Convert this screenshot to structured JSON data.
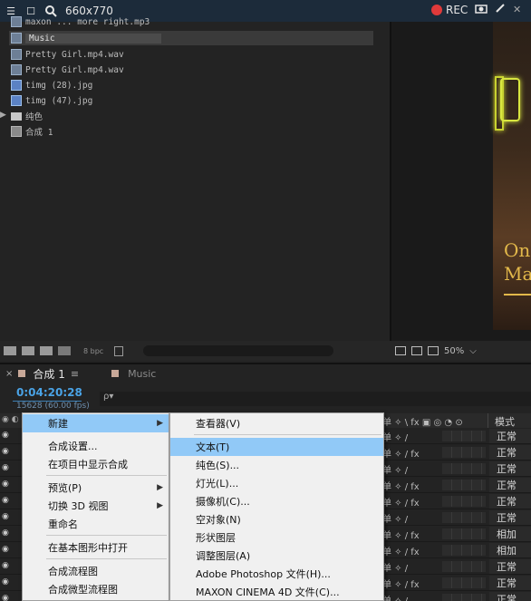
{
  "topbar": {
    "size_label": "660x770",
    "rec_label": "REC",
    "icons": [
      "menu-icon",
      "window-icon",
      "search-icon",
      "record-dot-icon",
      "camera-icon",
      "pen-icon",
      "close-icon"
    ]
  },
  "project": {
    "items": [
      {
        "label": "maxon ... more right.mp3",
        "icon": "audio-file-icon"
      },
      {
        "label": "Music",
        "icon": "audio-file-icon",
        "selected": true
      },
      {
        "label": "Pretty Girl.mp4.wav",
        "icon": "audio-file-icon"
      },
      {
        "label": "Pretty Girl.mp4.wav",
        "icon": "audio-file-icon"
      },
      {
        "label": "timg (28).jpg",
        "icon": "image-file-icon"
      },
      {
        "label": "timg (47).jpg",
        "icon": "image-file-icon"
      },
      {
        "label": "纯色",
        "icon": "folder-icon"
      },
      {
        "label": "合成 1",
        "icon": "composition-icon"
      }
    ],
    "footer": {
      "bpc": "8 bpc"
    }
  },
  "viewer": {
    "brand_line1": "On",
    "brand_line2": "Ma",
    "zoom": "50%"
  },
  "timeline": {
    "tab_active": "合成 1",
    "tab_other": "Music",
    "timecode": "0:04:20:28",
    "frames": "15628 (60.00 fps)",
    "search_placeholder": "ρ▾",
    "switches_header": "单 ✧ \\ fx ▣ ◎ ◔ ⊙",
    "mode_header": "模式",
    "rows": [
      {
        "mode": "正常",
        "sw": "单 ✧ /"
      },
      {
        "mode": "正常",
        "sw": "单 ✧ / fx"
      },
      {
        "mode": "正常",
        "sw": "单 ✧ /"
      },
      {
        "mode": "正常",
        "sw": "单 ✧ / fx"
      },
      {
        "mode": "正常",
        "sw": "单 ✧ / fx"
      },
      {
        "mode": "正常",
        "sw": "单 ✧ /"
      },
      {
        "mode": "正常",
        "sw": "单 ✧ /"
      },
      {
        "mode": "正常",
        "sw": "单 ✧ /"
      },
      {
        "mode": "相加",
        "sw": "单 ✧ / fx"
      },
      {
        "mode": "相加",
        "sw": "单 ✧ / fx"
      },
      {
        "mode": "正常",
        "sw": "单 ✧ /"
      },
      {
        "mode": "正常",
        "sw": "单 ✧ / fx"
      },
      {
        "mode": "正常",
        "sw": "单 ✧ /"
      }
    ]
  },
  "context_menu": {
    "items": [
      {
        "label": "新建",
        "submenu": true,
        "highlighted": true
      },
      {
        "label": "合成设置..."
      },
      {
        "label": "在项目中显示合成"
      },
      {
        "label": "预览(P)",
        "submenu": true
      },
      {
        "label": "切换 3D 视图",
        "submenu": true
      },
      {
        "label": "重命名"
      },
      {
        "label": "在基本图形中打开"
      },
      {
        "label": "合成流程图"
      },
      {
        "label": "合成微型流程图"
      }
    ]
  },
  "submenu": {
    "items": [
      {
        "label": "查看器(V)"
      },
      {
        "label": "文本(T)",
        "highlighted": true
      },
      {
        "label": "纯色(S)..."
      },
      {
        "label": "灯光(L)..."
      },
      {
        "label": "摄像机(C)..."
      },
      {
        "label": "空对象(N)"
      },
      {
        "label": "形状图层"
      },
      {
        "label": "调整图层(A)"
      },
      {
        "label": "Adobe Photoshop 文件(H)..."
      },
      {
        "label": "MAXON CINEMA 4D 文件(C)..."
      }
    ]
  }
}
